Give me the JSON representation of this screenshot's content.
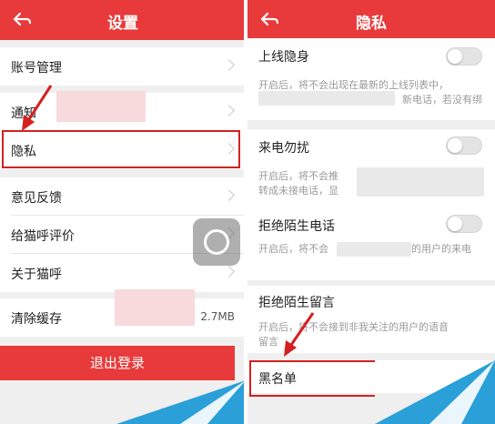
{
  "left_screen": {
    "title": "设置",
    "items": [
      {
        "label": "账号管理"
      },
      {
        "label": "通知"
      },
      {
        "label": "隐私"
      },
      {
        "label": "意见反馈"
      },
      {
        "label": "给猫呼评价"
      },
      {
        "label": "关于猫呼"
      },
      {
        "label": "清除缓存",
        "value": "2.7MB"
      }
    ],
    "logout_label": "退出登录"
  },
  "right_screen": {
    "title": "隐私",
    "items": [
      {
        "label": "上线隐身",
        "desc": "开启后，将不会出现在最新的上线列表中，",
        "desc2": "新电话，若没有绑"
      },
      {
        "label": "来电勿扰",
        "desc": "开启后，将不会推",
        "desc2": "转成未接电话，显"
      },
      {
        "label": "拒绝陌生电话",
        "desc": "开启后，将不会",
        "desc2": "的用户的来电"
      },
      {
        "label": "拒绝陌生留言",
        "desc": "开启后，将不会接到非我关注的用户的语音",
        "desc2": "留言"
      },
      {
        "label": "黑名单"
      }
    ]
  },
  "colors": {
    "accent": "#e83a3a",
    "highlight": "#d42020"
  },
  "icons": {
    "back": "back-arrow-icon",
    "chevron": "chevron-right-icon"
  }
}
